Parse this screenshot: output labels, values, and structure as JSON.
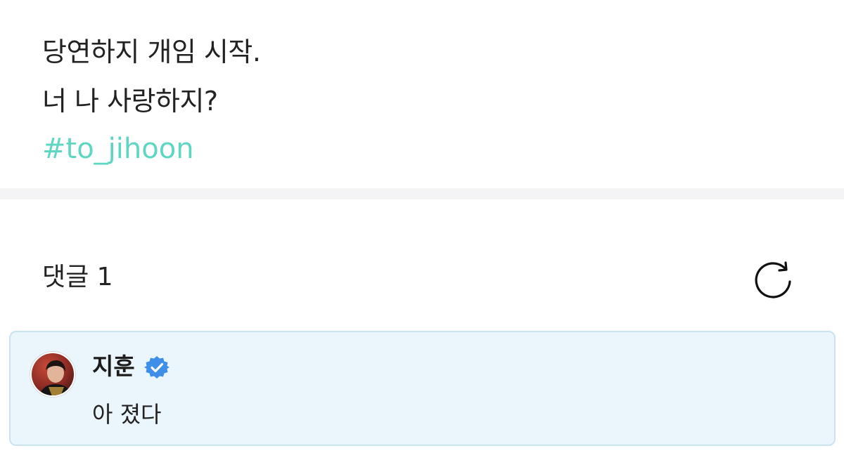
{
  "post": {
    "line1": "당연하지 개임 시작.",
    "line2": "너 나 사랑하지?",
    "hashtag": "#to_jihoon"
  },
  "comments": {
    "title": "댓글 1",
    "refresh_icon": "refresh-icon",
    "items": [
      {
        "author": "지훈",
        "verified": true,
        "verified_icon": "verified-badge-icon",
        "text": "아 졌다"
      }
    ]
  },
  "colors": {
    "accent": "#5fd6c2",
    "verified": "#3d8fe8",
    "card_bg": "#eaf6fc",
    "card_border": "#c9e3ef"
  }
}
